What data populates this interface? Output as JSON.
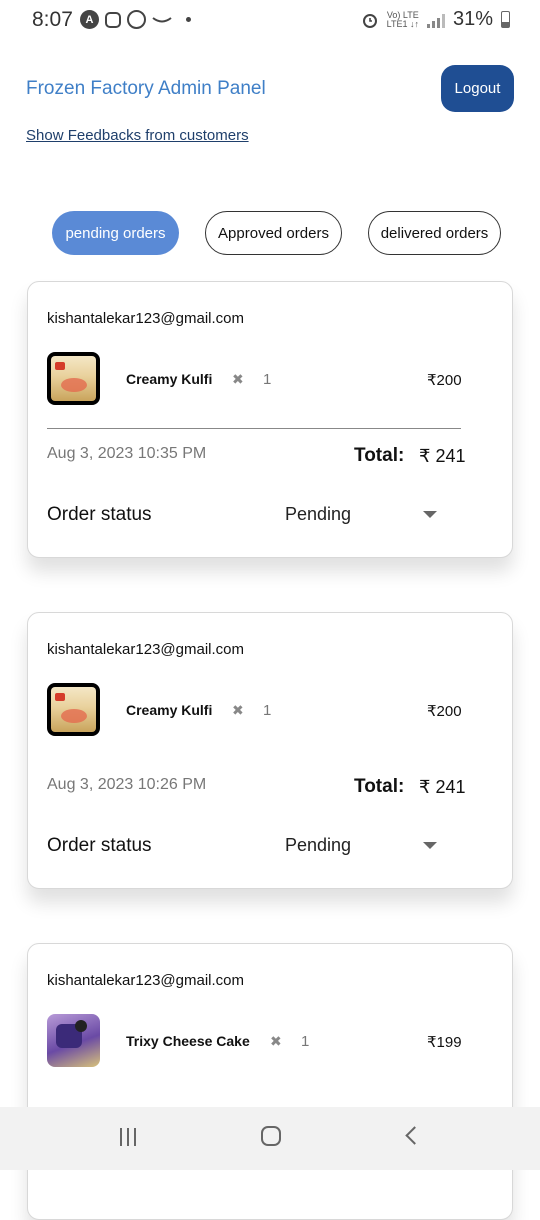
{
  "status_bar": {
    "time": "8:07",
    "battery": "31%",
    "network_top": "Vo) LTE",
    "network_bottom": "LTE1 ↓↑"
  },
  "header": {
    "title": "Frozen Factory Admin Panel",
    "logout_label": "Logout",
    "feedback_link": "Show Feedbacks from customers"
  },
  "tabs": [
    {
      "label": "pending orders",
      "active": true
    },
    {
      "label": "Approved orders",
      "active": false
    },
    {
      "label": "delivered orders",
      "active": false
    }
  ],
  "orders": [
    {
      "email": "kishantalekar123@gmail.com",
      "product_name": "Creamy Kulfi",
      "qty_symbol": "✖",
      "quantity": "1",
      "price": "₹200",
      "date": "Aug 3, 2023 10:35 PM",
      "total_label": "Total:",
      "total_value": "₹ 241",
      "status_label": "Order status",
      "status_value": "Pending"
    },
    {
      "email": "kishantalekar123@gmail.com",
      "product_name": "Creamy Kulfi",
      "qty_symbol": "✖",
      "quantity": "1",
      "price": "₹200",
      "date": "Aug 3, 2023 10:26 PM",
      "total_label": "Total:",
      "total_value": "₹ 241",
      "status_label": "Order status",
      "status_value": "Pending"
    },
    {
      "email": "kishantalekar123@gmail.com",
      "product_name": "Trixy Cheese Cake",
      "qty_symbol": "✖",
      "quantity": "1",
      "price": "₹199"
    }
  ],
  "icons": {
    "status_left": [
      "app-a-icon",
      "instagram-icon",
      "messenger-icon",
      "amazon-icon",
      "dot-icon"
    ],
    "status_right": [
      "alarm-icon",
      "signal-icon",
      "battery-icon"
    ],
    "nav": [
      "recents-icon",
      "home-icon",
      "back-icon"
    ],
    "dropdown": "chevron-down-icon"
  },
  "colors": {
    "title": "#3f7fc7",
    "logout_bg": "#1f4e93",
    "active_tab": "#5a8ad6"
  }
}
